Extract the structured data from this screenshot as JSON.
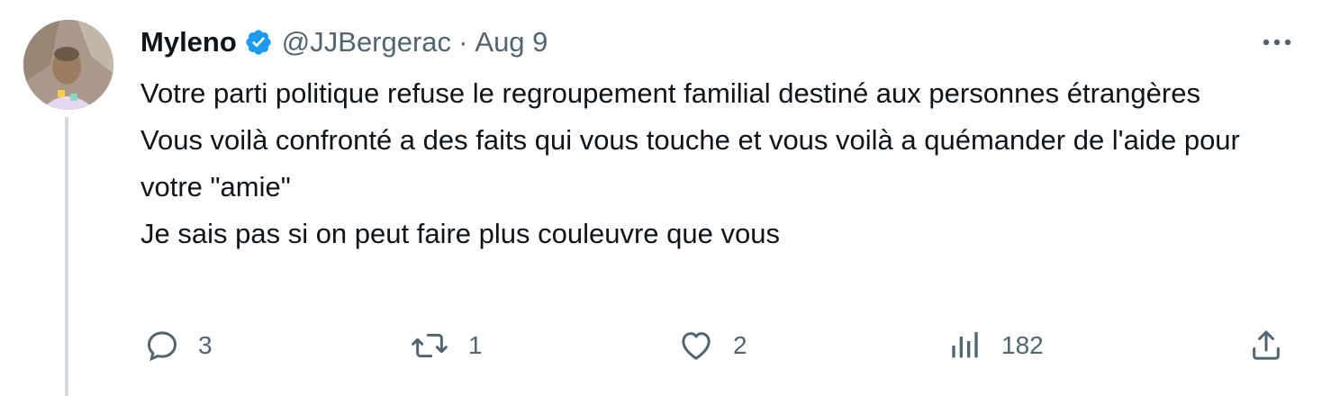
{
  "tweet": {
    "author": {
      "display_name": "Myleno",
      "handle": "@JJBergerac",
      "verified": true
    },
    "separator": "·",
    "date": "Aug 9",
    "text": "Votre parti politique refuse le regroupement familial destiné aux personnes étrangères\nVous voilà confronté a des faits qui vous touche et vous voilà a quémander de l'aide pour votre \"amie\"\nJe sais pas si on peut faire plus couleuvre que vous",
    "actions": {
      "replies": "3",
      "retweets": "1",
      "likes": "2",
      "views": "182"
    }
  },
  "icons": {
    "verified": "verified-badge-icon",
    "more": "more-horizontal-icon",
    "reply": "reply-icon",
    "retweet": "retweet-icon",
    "like": "heart-icon",
    "views": "analytics-icon",
    "share": "share-icon"
  },
  "colors": {
    "text": "#0f1419",
    "secondary": "#536471",
    "verified_blue": "#1d9bf0",
    "thread_line": "#cfd9de"
  }
}
